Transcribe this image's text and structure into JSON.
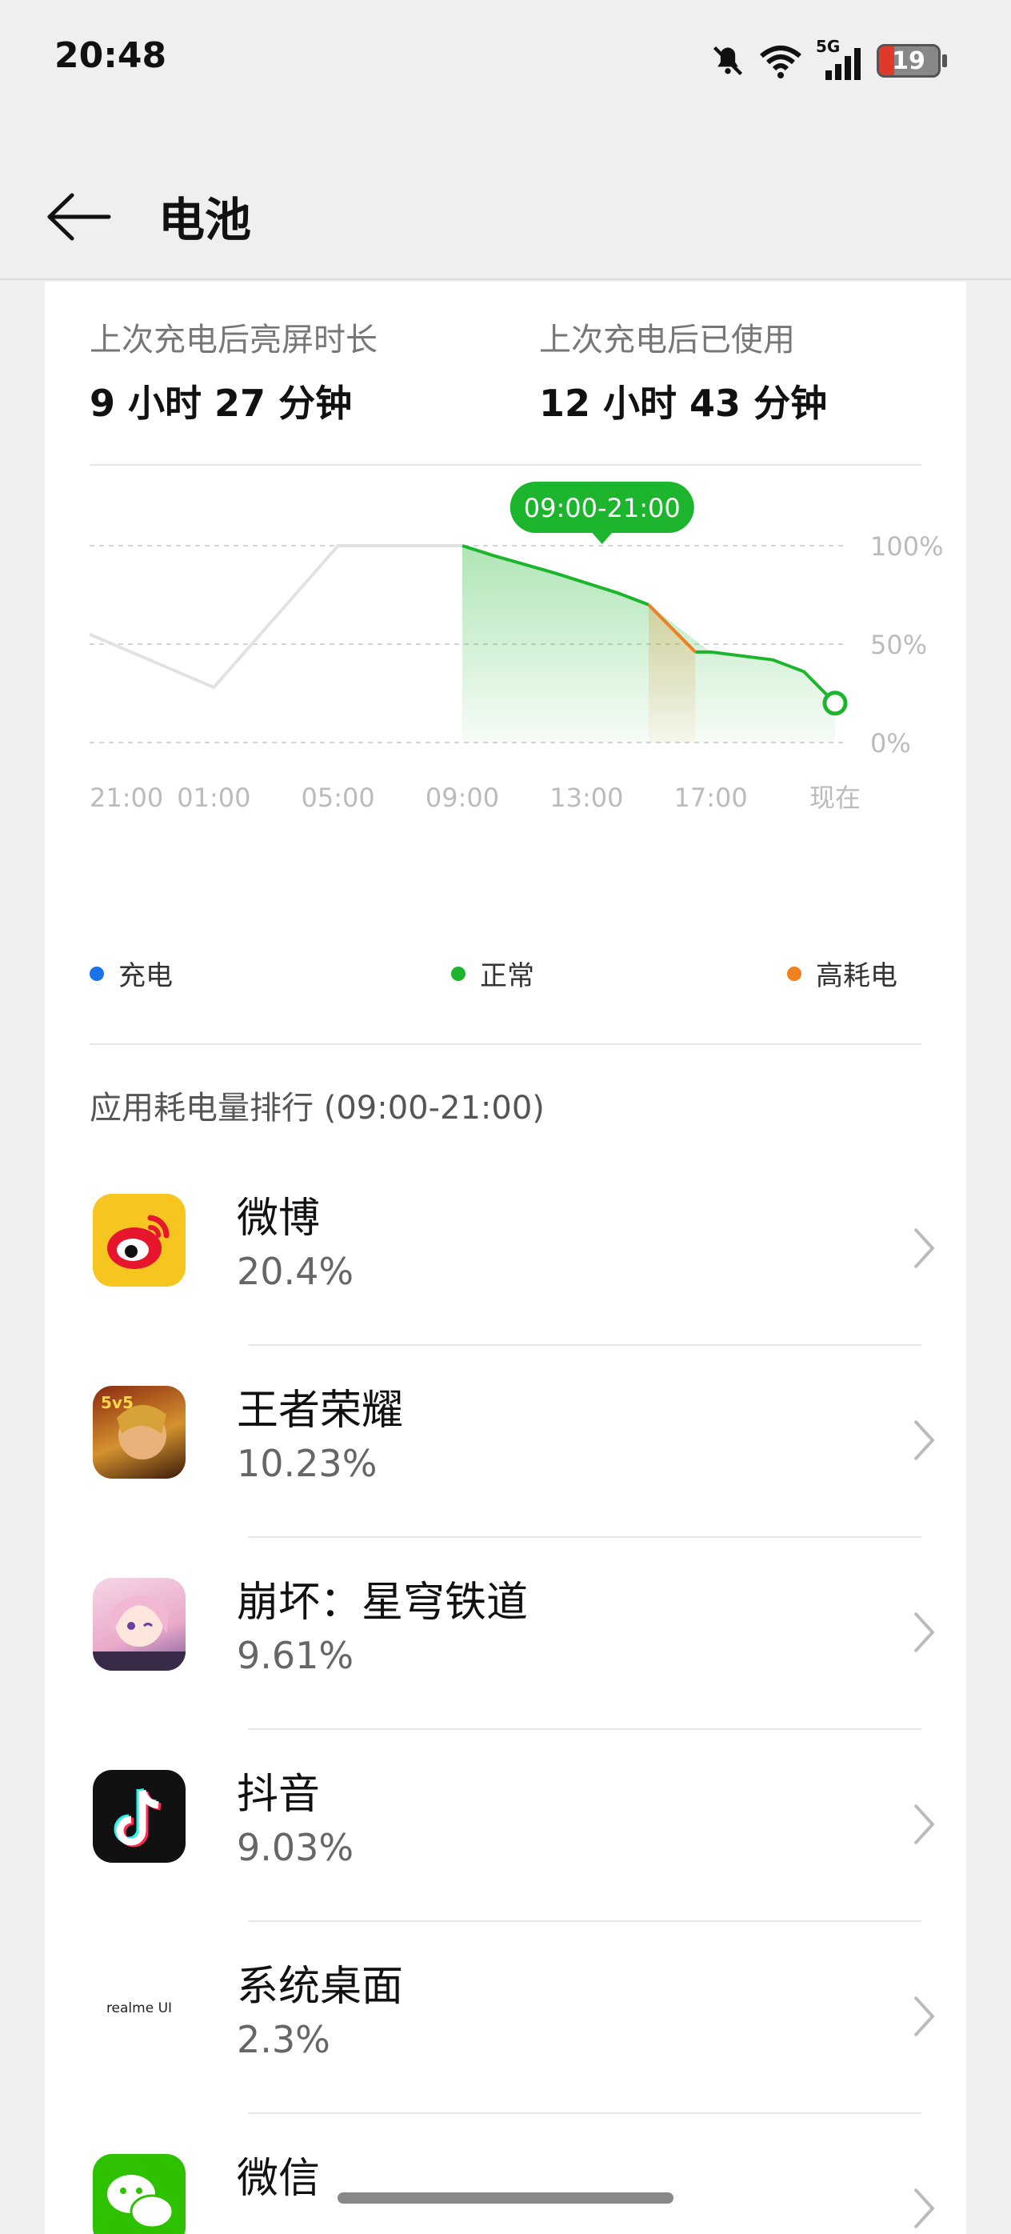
{
  "status_bar": {
    "time": "20:48",
    "network": "5G",
    "battery": "19"
  },
  "header": {
    "title": "电池"
  },
  "stats": [
    {
      "label": "上次充电后亮屏时长",
      "value": "9 小时 27 分钟"
    },
    {
      "label": "上次充电后已使用",
      "value": "12 小时 43 分钟"
    }
  ],
  "chart_data": {
    "type": "line",
    "tooltip": "09:00-21:00",
    "x_ticks": [
      "21:00",
      "01:00",
      "05:00",
      "09:00",
      "13:00",
      "17:00",
      "现在"
    ],
    "y_ticks": [
      "100%",
      "50%",
      "0%"
    ],
    "ylim": [
      0,
      100
    ],
    "series": [
      {
        "name": "充电",
        "color": "#1a73e8",
        "points": []
      },
      {
        "name": "正常",
        "color": "#1db52d",
        "points": [
          [
            0,
            55
          ],
          [
            4,
            28
          ],
          [
            8,
            100
          ],
          [
            12,
            100
          ],
          [
            13,
            95
          ],
          [
            15,
            86
          ],
          [
            17,
            76
          ],
          [
            18,
            70
          ],
          [
            20,
            46
          ],
          [
            22,
            42
          ],
          [
            23,
            36
          ],
          [
            24,
            20
          ]
        ]
      },
      {
        "name": "高耗电",
        "color": "#f07f1d",
        "points": [
          [
            18,
            70
          ],
          [
            19.5,
            46
          ]
        ]
      }
    ],
    "grid": true
  },
  "legend": [
    {
      "label": "充电",
      "color": "#1a73e8"
    },
    {
      "label": "正常",
      "color": "#1db52d"
    },
    {
      "label": "高耗电",
      "color": "#f07f1d"
    }
  ],
  "ranking": {
    "title": "应用耗电量排行 (09:00-21:00)",
    "apps": [
      {
        "name": "微博",
        "percent": "20.4%",
        "icon": "weibo-icon"
      },
      {
        "name": "王者荣耀",
        "percent": "10.23%",
        "icon": "honor-of-kings-icon"
      },
      {
        "name": "崩坏：星穹铁道",
        "percent": "9.61%",
        "icon": "honkai-star-rail-icon"
      },
      {
        "name": "抖音",
        "percent": "9.03%",
        "icon": "douyin-icon"
      },
      {
        "name": "系统桌面",
        "percent": "2.3%",
        "icon": "realme-ui-icon"
      },
      {
        "name": "微信",
        "percent": "",
        "icon": "wechat-icon"
      }
    ],
    "realme_text": "realme UI"
  }
}
